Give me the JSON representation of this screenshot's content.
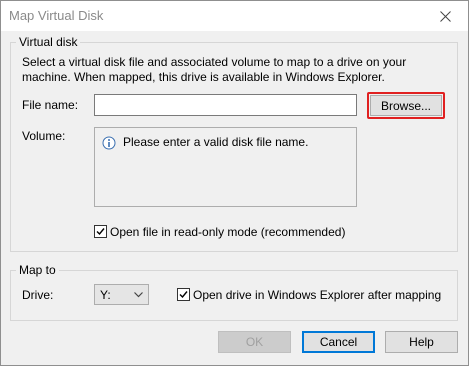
{
  "window": {
    "title": "Map Virtual Disk"
  },
  "virtual_disk": {
    "group_label": "Virtual disk",
    "description": "Select a virtual disk file and associated volume to map to a drive on your machine. When mapped, this drive is available in Windows Explorer.",
    "file_name_label": "File name:",
    "file_name_value": "",
    "browse_label": "Browse...",
    "volume_label": "Volume:",
    "volume_message": "Please enter a valid disk file name.",
    "read_only_label": "Open file in read-only mode (recommended)",
    "read_only_checked": true
  },
  "map_to": {
    "group_label": "Map to",
    "drive_label": "Drive:",
    "drive_value": "Y:",
    "open_explorer_label": "Open drive in Windows Explorer after mapping",
    "open_explorer_checked": true
  },
  "buttons": {
    "ok": "OK",
    "cancel": "Cancel",
    "help": "Help"
  },
  "icons": {
    "close": "close-icon",
    "info": "info-icon",
    "dropdown": "chevron-down-icon",
    "check": "check-icon"
  },
  "colors": {
    "highlight": "#e02020",
    "focus_border": "#0078d7",
    "disabled_text": "#a0a0a0"
  }
}
